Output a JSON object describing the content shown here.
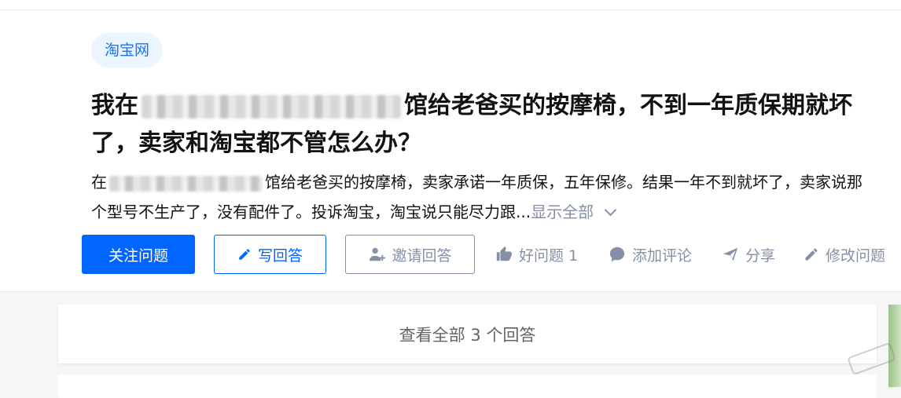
{
  "topic_tag": "淘宝网",
  "question": {
    "title_start": "我在",
    "title_end": "馆给老爸买的按摩椅，不到一年质保期就坏了，卖家和淘宝都不管怎么办？",
    "excerpt_start": "在",
    "excerpt_end": "馆给老爸买的按摩椅，卖家承诺一年质保，五年保修。结果一年不到就坏了，卖家说那个型号不生产了，没有配件了。投诉淘宝，淘宝说只能尽力跟...",
    "show_all": "显示全部"
  },
  "buttons": {
    "follow": "关注问题",
    "write": "写回答",
    "invite": "邀请回答"
  },
  "actions": {
    "good_question": "好问题 1",
    "comment": "添加评论",
    "share": "分享",
    "edit": "修改问题"
  },
  "answers_link": "查看全部 3 个回答",
  "icons": [
    "pencil-icon",
    "invite-user-icon",
    "thumbs-up-icon",
    "comment-bubble-icon",
    "share-plane-icon",
    "edit-pencil-icon",
    "chevron-down-icon"
  ],
  "colors": {
    "primary": "#0066ff",
    "muted": "#8590a6",
    "tag_bg": "#ebf5ff",
    "tag_text": "#1772f6"
  }
}
